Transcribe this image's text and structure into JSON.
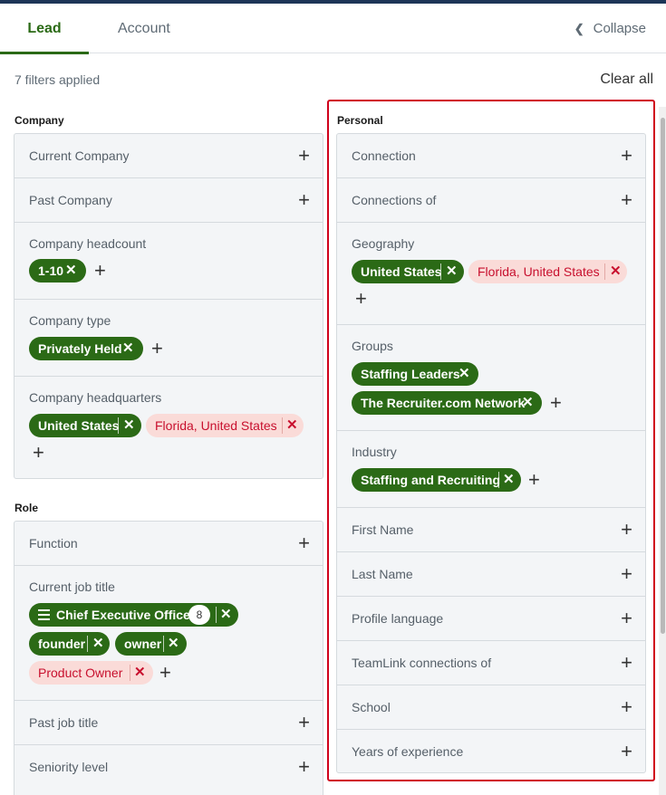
{
  "tabs": {
    "lead": "Lead",
    "account": "Account"
  },
  "collapse_label": "Collapse",
  "filters_applied": "7 filters applied",
  "clear_all": "Clear all",
  "company": {
    "title": "Company",
    "current_company": "Current Company",
    "past_company": "Past Company",
    "headcount": {
      "label": "Company headcount",
      "chips": [
        "1-10"
      ]
    },
    "type": {
      "label": "Company type",
      "chips": [
        "Privately Held"
      ]
    },
    "headquarters": {
      "label": "Company headquarters",
      "include": "United States",
      "exclude": "Florida, United States"
    }
  },
  "role": {
    "title": "Role",
    "function": "Function",
    "current_job_title": {
      "label": "Current job title",
      "group_chip": "Chief Executive Officer",
      "group_count": "8",
      "chips": [
        "founder",
        "owner"
      ],
      "exclude": "Product Owner"
    },
    "past_job_title": "Past job title",
    "seniority": "Seniority level"
  },
  "personal": {
    "title": "Personal",
    "connection": "Connection",
    "connections_of": "Connections of",
    "geography": {
      "label": "Geography",
      "include": "United States",
      "exclude": "Florida, United States"
    },
    "groups": {
      "label": "Groups",
      "chips": [
        "Staffing Leaders",
        "The Recruiter.com Network"
      ]
    },
    "industry": {
      "label": "Industry",
      "chips": [
        "Staffing and Recruiting"
      ]
    },
    "first_name": "First Name",
    "last_name": "Last Name",
    "profile_language": "Profile language",
    "teamlink": "TeamLink connections of",
    "school": "School",
    "years_experience": "Years of experience"
  },
  "icons": {
    "plus": "plus-icon",
    "remove": "close-icon",
    "chevron": "chevron-left-icon",
    "list": "list-icon"
  },
  "colors": {
    "accent": "#2b6a16",
    "exclude_bg": "#fadbd8",
    "exclude_text": "#c8102e",
    "highlight": "#d0021b"
  }
}
